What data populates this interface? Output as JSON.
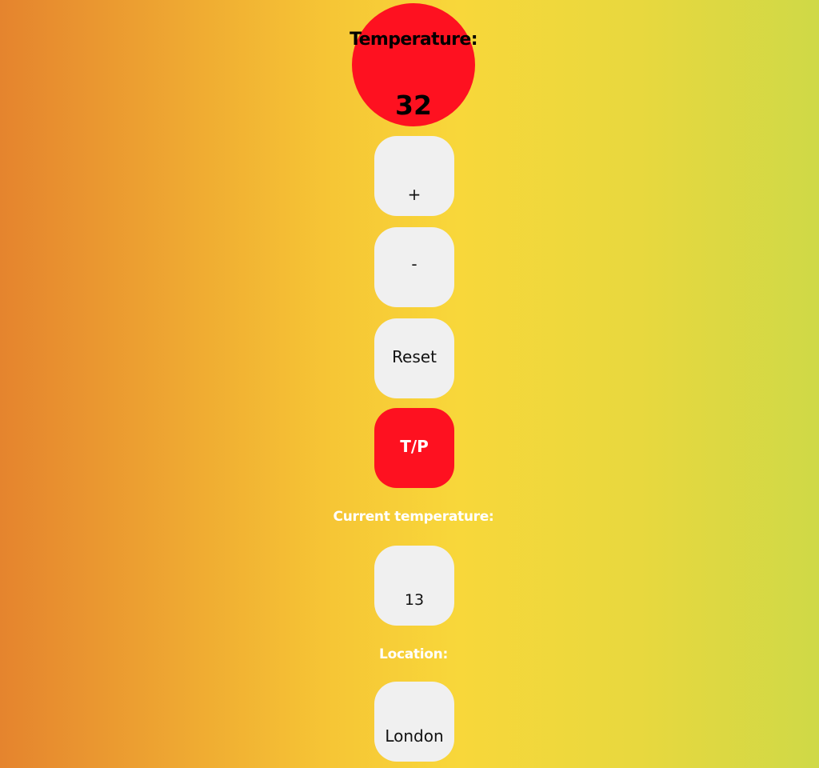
{
  "display": {
    "title": "Temperature:",
    "value": "32",
    "color": "#fe1120"
  },
  "buttons": {
    "increase": "+",
    "decrease": "-",
    "reset": "Reset",
    "toggle": "T/P"
  },
  "current": {
    "label": "Current temperature:",
    "value": "13"
  },
  "location": {
    "label": "Location:",
    "value": "London"
  },
  "colors": {
    "accent": "#fe1120",
    "tile": "#f0f0f0",
    "gradient_left": "#e5842e",
    "gradient_mid": "#f8d73a",
    "gradient_right": "#cfd947"
  }
}
